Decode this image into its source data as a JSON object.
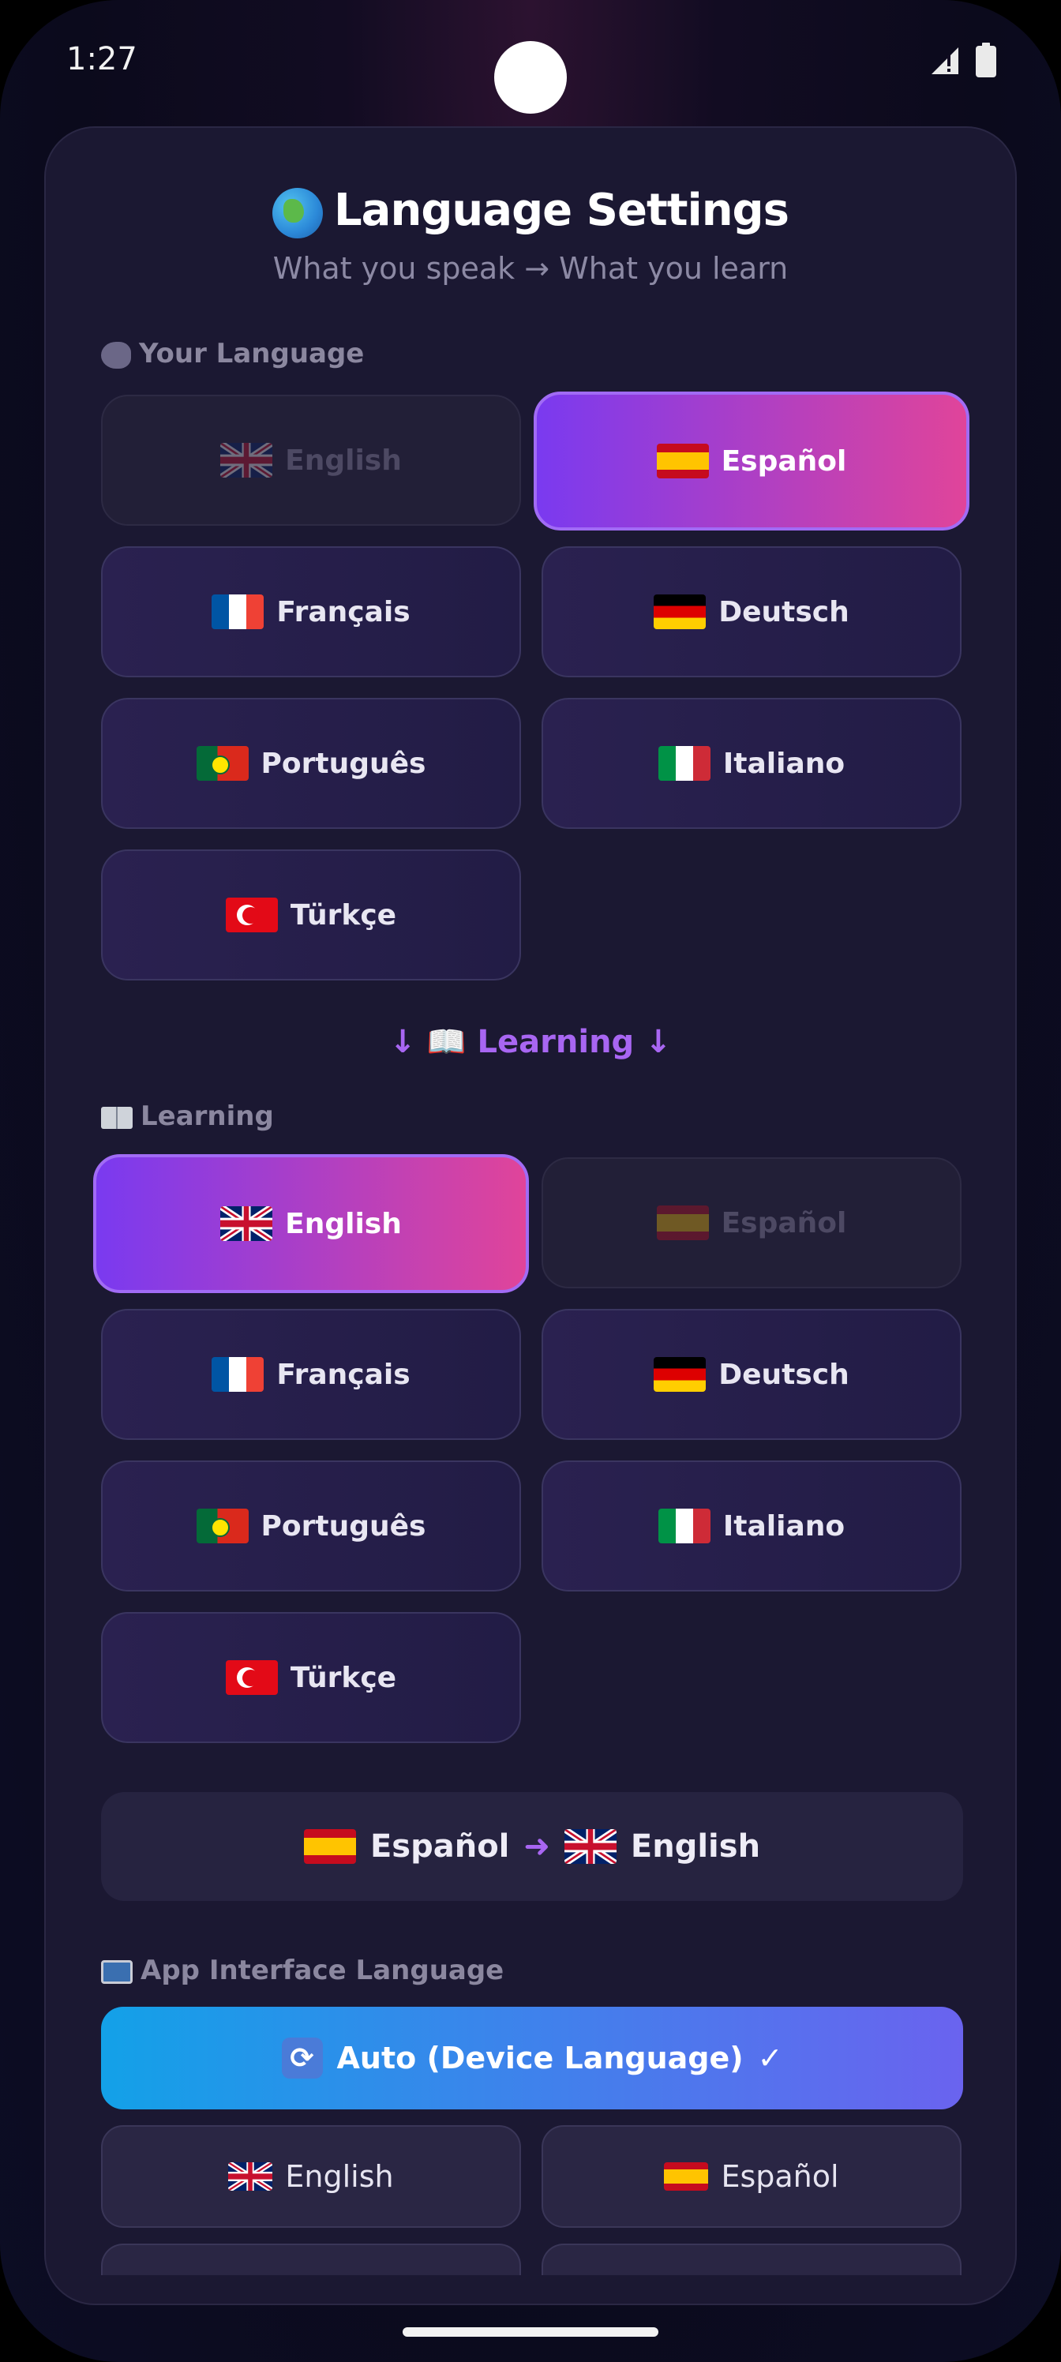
{
  "status_bar": {
    "time": "1:27"
  },
  "header": {
    "title": "Language Settings",
    "subtitle": "What you speak → What you learn"
  },
  "your_language": {
    "label": "Your Language",
    "options": [
      {
        "name": "English",
        "flag": "gb",
        "state": "disabled"
      },
      {
        "name": "Español",
        "flag": "es",
        "state": "selected"
      },
      {
        "name": "Français",
        "flag": "fr",
        "state": "normal"
      },
      {
        "name": "Deutsch",
        "flag": "de",
        "state": "normal"
      },
      {
        "name": "Português",
        "flag": "pt",
        "state": "normal"
      },
      {
        "name": "Italiano",
        "flag": "it",
        "state": "normal"
      },
      {
        "name": "Türkçe",
        "flag": "tr",
        "state": "normal"
      }
    ]
  },
  "divider": {
    "text": "↓ 📖 Learning ↓"
  },
  "learning": {
    "label": "Learning",
    "options": [
      {
        "name": "English",
        "flag": "gb",
        "state": "selected"
      },
      {
        "name": "Español",
        "flag": "es",
        "state": "disabled"
      },
      {
        "name": "Français",
        "flag": "fr",
        "state": "normal"
      },
      {
        "name": "Deutsch",
        "flag": "de",
        "state": "normal"
      },
      {
        "name": "Português",
        "flag": "pt",
        "state": "normal"
      },
      {
        "name": "Italiano",
        "flag": "it",
        "state": "normal"
      },
      {
        "name": "Türkçe",
        "flag": "tr",
        "state": "normal"
      }
    ]
  },
  "summary": {
    "from": "Español",
    "arrow": "➜",
    "to": "English"
  },
  "app_interface": {
    "label": "App Interface Language",
    "auto_label": "Auto (Device Language)",
    "auto_check": "✓",
    "options": [
      {
        "name": "English",
        "flag": "gb"
      },
      {
        "name": "Español",
        "flag": "es"
      }
    ]
  },
  "colors": {
    "accent_purple": "#7a3af0",
    "accent_pink": "#e0449a",
    "auto_blue": "#13a1e8",
    "card_bg": "#1b1832"
  }
}
